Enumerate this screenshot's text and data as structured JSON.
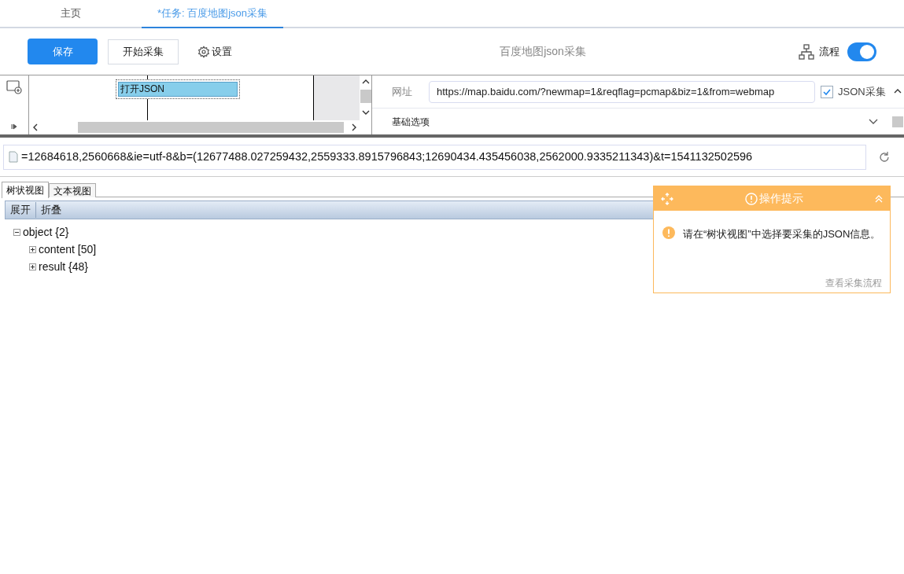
{
  "tabs": [
    {
      "label": "主页",
      "selected": false
    },
    {
      "label": "*任务: 百度地图json采集",
      "selected": true
    }
  ],
  "toolbar": {
    "buttons": [
      {
        "label": "保存",
        "kind": "primary"
      },
      {
        "label": "开始采集",
        "kind": "outline"
      },
      {
        "label": "设置",
        "kind": "settings"
      }
    ],
    "title": "百度地图json采集",
    "flow": {
      "label": "流程",
      "on": true
    }
  },
  "designer": {
    "node": "打开JSON"
  },
  "options": {
    "url_label": "网址",
    "url": "https://map.baidu.com/?newmap=1&reqflag=pcmap&biz=1&from=webmap",
    "json_checkbox": {
      "label": "JSON采集",
      "checked": true
    },
    "section": "基础选项"
  },
  "address": "=12684618,2560668&ie=utf-8&b=(12677488.027259432,2559333.8915796843;12690434.435456038,2562000.9335211343)&t=1541132502596",
  "view_tabs": [
    {
      "label": "树状视图",
      "selected": true
    },
    {
      "label": "文本视图",
      "selected": false
    }
  ],
  "tree_toolbar": [
    "展开",
    "折叠"
  ],
  "tree": [
    {
      "label": "object {2}",
      "expanded": true,
      "children": [
        {
          "label": "content [50]",
          "expanded": false
        },
        {
          "label": "result {48}",
          "expanded": false
        }
      ]
    }
  ],
  "hint": {
    "title": "操作提示",
    "message": "请在“树状视图”中选择要采集的JSON信息。",
    "link": "查看采集流程"
  }
}
